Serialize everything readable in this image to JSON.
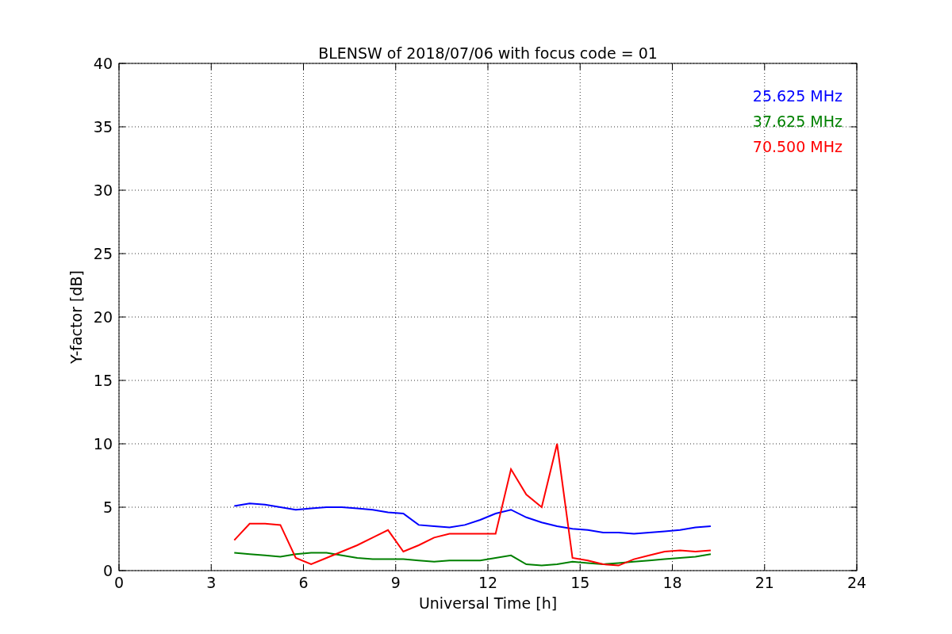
{
  "chart_data": {
    "type": "line",
    "title": "BLENSW of 2018/07/06 with focus code = 01",
    "xlabel": "Universal Time [h]",
    "ylabel": "Y-factor [dB]",
    "x": [
      3.75,
      4.25,
      4.75,
      5.25,
      5.75,
      6.25,
      6.75,
      7.25,
      7.75,
      8.25,
      8.75,
      9.25,
      9.75,
      10.25,
      10.75,
      11.25,
      11.75,
      12.25,
      12.75,
      13.25,
      13.75,
      14.25,
      14.75,
      15.25,
      15.75,
      16.25,
      16.75,
      17.25,
      17.75,
      18.25,
      18.75,
      19.25
    ],
    "series": [
      {
        "name": "25.625 MHz",
        "color": "#0000ff",
        "values": [
          5.1,
          5.3,
          5.2,
          5.0,
          4.8,
          4.9,
          5.0,
          5.0,
          4.9,
          4.8,
          4.6,
          4.5,
          3.6,
          3.5,
          3.4,
          3.6,
          4.0,
          4.5,
          4.8,
          4.2,
          3.8,
          3.5,
          3.3,
          3.2,
          3.0,
          3.0,
          2.9,
          3.0,
          3.1,
          3.2,
          3.4,
          3.5
        ]
      },
      {
        "name": "37.625 MHz",
        "color": "#008000",
        "values": [
          1.4,
          1.3,
          1.2,
          1.1,
          1.3,
          1.4,
          1.4,
          1.2,
          1.0,
          0.9,
          0.9,
          0.9,
          0.8,
          0.7,
          0.8,
          0.8,
          0.8,
          1.0,
          1.2,
          0.5,
          0.4,
          0.5,
          0.7,
          0.6,
          0.5,
          0.6,
          0.7,
          0.8,
          0.9,
          1.0,
          1.1,
          1.3
        ]
      },
      {
        "name": "70.500 MHz",
        "color": "#ff0000",
        "values": [
          2.4,
          3.7,
          3.7,
          3.6,
          1.0,
          0.5,
          1.0,
          1.5,
          2.0,
          2.6,
          3.2,
          1.5,
          2.0,
          2.6,
          2.9,
          2.9,
          2.9,
          2.9,
          8.0,
          6.0,
          5.0,
          10.0,
          1.0,
          0.8,
          0.5,
          0.4,
          0.9,
          1.2,
          1.5,
          1.6,
          1.5,
          1.6
        ]
      }
    ],
    "grid": true,
    "xlim": [
      0,
      24
    ],
    "ylim": [
      0,
      40
    ],
    "xticks": [
      0,
      3,
      6,
      9,
      12,
      15,
      18,
      21,
      24
    ],
    "yticks": [
      0,
      5,
      10,
      15,
      20,
      25,
      30,
      35,
      40
    ]
  }
}
